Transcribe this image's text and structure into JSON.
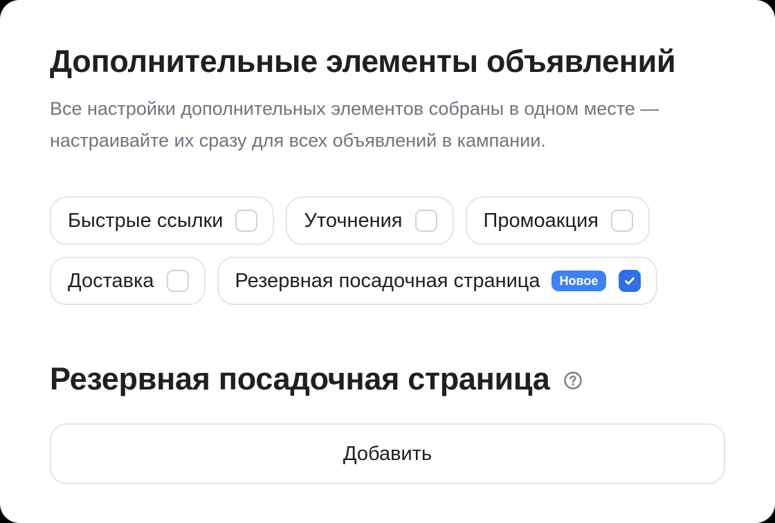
{
  "header": {
    "title": "Дополнительные элементы объявлений",
    "subtitle": "Все настройки дополнительных элементов собраны в одном месте — настраивайте их сразу для всех объявлений в кампании."
  },
  "chips": {
    "row1": [
      {
        "label": "Быстрые ссылки",
        "checked": false
      },
      {
        "label": "Уточнения",
        "checked": false
      },
      {
        "label": "Промоакция",
        "checked": false
      }
    ],
    "row2": [
      {
        "label": "Доставка",
        "checked": false
      },
      {
        "label": "Резервная посадочная страница",
        "badge": "Новое",
        "checked": true
      }
    ]
  },
  "section": {
    "title": "Резервная посадочная страница",
    "help_icon": "question-circle-icon",
    "add_label": "Добавить"
  },
  "colors": {
    "accent": "#2f6fe8",
    "badge": "#3b82f6",
    "text": "#21201f",
    "muted": "#6f7580",
    "border": "#e3e5e8"
  }
}
